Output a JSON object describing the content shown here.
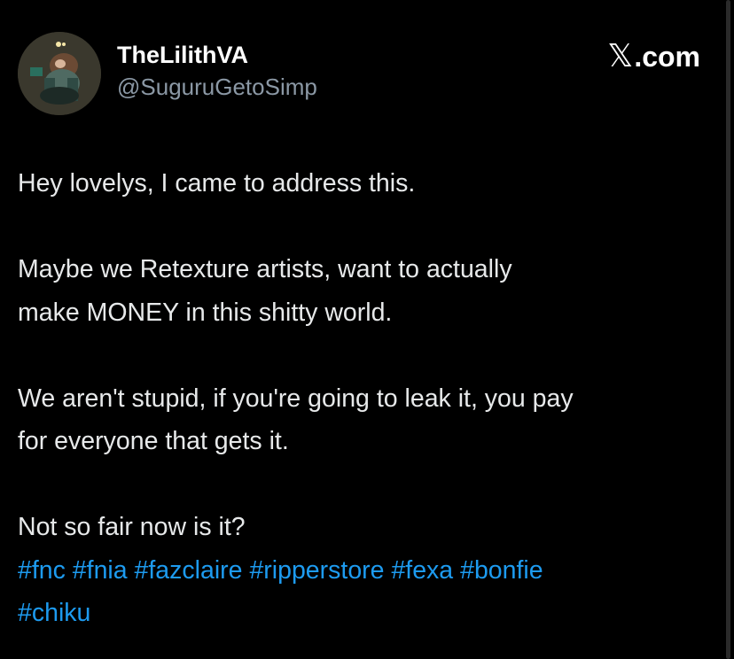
{
  "author": {
    "display_name": "TheLilithVA",
    "handle": "@SuguruGetoSimp",
    "avatar_icon": "profile-avatar"
  },
  "brand": {
    "x_glyph": "𝕏",
    "domain": ".com"
  },
  "tweet": {
    "line_1": "Hey lovelys, I came to address this.",
    "line_2": "Maybe we Retexture artists, want to actually",
    "line_3": "make MONEY in this shitty world.",
    "line_4": "We aren't stupid, if you're going to leak it, you pay",
    "line_5": "for everyone that gets it.",
    "line_6": "Not so fair now is it?",
    "hashtags": [
      "#fnc",
      "#fnia",
      "#fazclaire",
      "#ripperstore",
      "#fexa",
      "#bonfie",
      "#chiku"
    ]
  },
  "colors": {
    "background": "#000000",
    "text": "#e7e9ea",
    "secondary_text": "#8b98a5",
    "link": "#1d9bf0"
  }
}
